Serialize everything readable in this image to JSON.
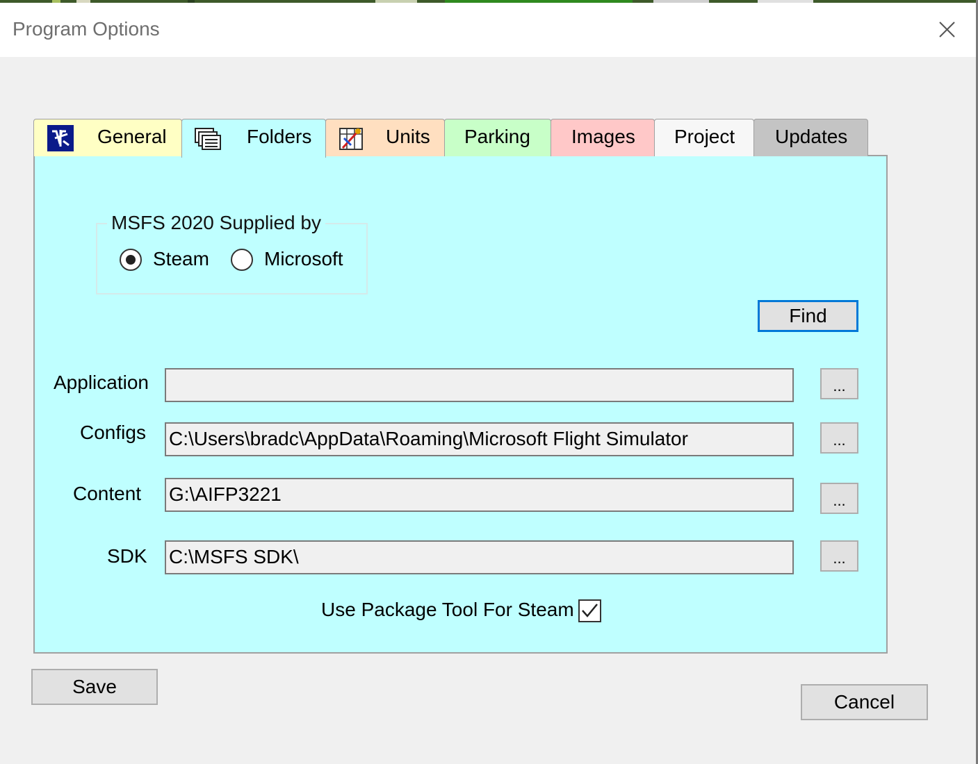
{
  "window": {
    "title": "Program Options",
    "close_icon": "close-icon"
  },
  "tabs": [
    {
      "label": "General",
      "icon": "app-logo-icon",
      "color": "#ffffc4"
    },
    {
      "label": "Folders",
      "icon": "folders-icon",
      "color": "#bfffff",
      "selected": true
    },
    {
      "label": "Units",
      "icon": "units-icon",
      "color": "#ffdfc0"
    },
    {
      "label": "Parking",
      "icon": "",
      "color": "#c8ffc8"
    },
    {
      "label": "Images",
      "icon": "",
      "color": "#ffc8c8"
    },
    {
      "label": "Project",
      "icon": "",
      "color": "#f7f7f7"
    },
    {
      "label": "Updates",
      "icon": "",
      "color": "#c4c4c4"
    }
  ],
  "group": {
    "legend": "MSFS 2020 Supplied by",
    "options": [
      {
        "label": "Steam",
        "selected": true
      },
      {
        "label": "Microsoft",
        "selected": false
      }
    ]
  },
  "find_button": "Find",
  "browse_label": "...",
  "fields": [
    {
      "label": "Application",
      "value": ""
    },
    {
      "label": "Configs",
      "value": "C:\\Users\\bradc\\AppData\\Roaming\\Microsoft Flight Simulator"
    },
    {
      "label": "Content",
      "value": "G:\\AIFP3221"
    },
    {
      "label": "SDK",
      "value": "C:\\MSFS SDK\\"
    }
  ],
  "package_tool": {
    "label": "Use Package Tool For Steam",
    "checked": true
  },
  "save_button": "Save",
  "cancel_button": "Cancel",
  "colors": {
    "panel": "#bfffff",
    "focus_border": "#0078d7"
  }
}
